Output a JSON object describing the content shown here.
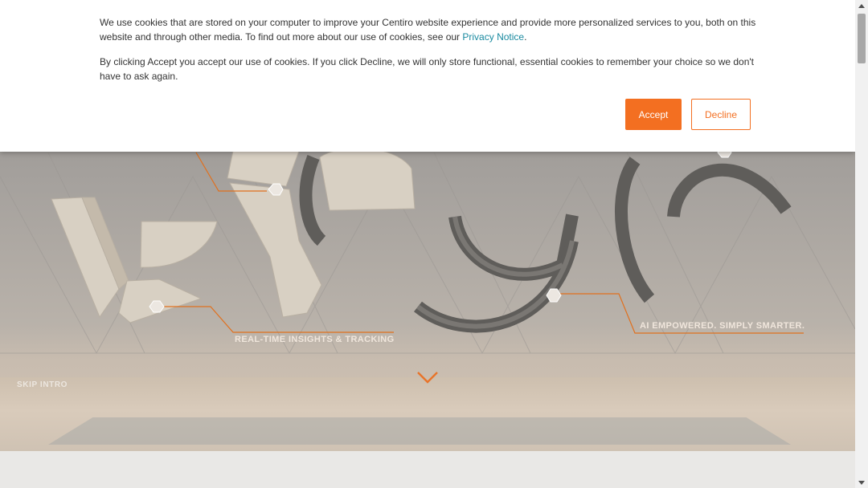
{
  "cookie_banner": {
    "paragraph1_text": "We use cookies that are stored on your computer to improve your Centiro website experience and provide more personalized services to you, both on this website and through other media. To find out more about our use of cookies, see our ",
    "privacy_link": "Privacy Notice",
    "paragraph1_end": ".",
    "paragraph2_text": "By clicking Accept you accept our use of cookies. If you click Decline, we will only store functional, essential cookies to remember your choice so we don't have to ask again.",
    "accept_label": "Accept",
    "decline_label": "Decline"
  },
  "hero": {
    "callout_left": "REAL-TIME INSIGHTS & TRACKING",
    "callout_right": "AI EMPOWERED. SIMPLY SMARTER.",
    "skip_intro": "SKIP INTRO",
    "chevron_icon": "chevron-down-icon"
  },
  "colors": {
    "accent": "#f36f21",
    "link": "#1a8aa0"
  }
}
